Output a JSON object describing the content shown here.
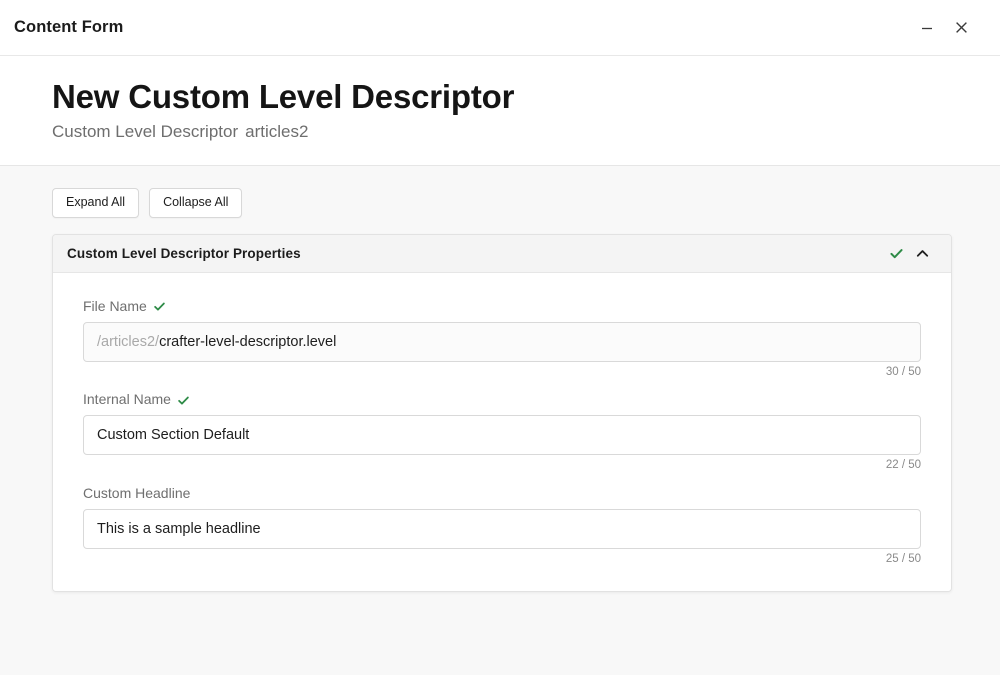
{
  "window": {
    "title": "Content Form",
    "minimize_label": "Minimize",
    "close_label": "Close",
    "minimize_icon": "minimize-icon",
    "close_icon": "close-icon"
  },
  "page_header": {
    "title": "New Custom Level Descriptor",
    "subtitle_type": "Custom Level Descriptor",
    "subtitle_path": "articles2"
  },
  "toolbar": {
    "expand_all_label": "Expand All",
    "collapse_all_label": "Collapse All"
  },
  "section": {
    "title": "Custom Level Descriptor Properties",
    "valid_icon": "check-icon",
    "toggle_icon": "chevron-up-icon",
    "expanded": true,
    "valid_color": "#2e8b47"
  },
  "fields": [
    {
      "label": "File Name",
      "has_check": true,
      "prefix": "/articles2/",
      "value": "crafter-level-descriptor.level",
      "placeholder": "",
      "counter": "30 / 50",
      "readonly_style": true
    },
    {
      "label": "Internal Name",
      "has_check": true,
      "prefix": "",
      "value": "Custom Section Default",
      "placeholder": "",
      "counter": "22 / 50",
      "readonly_style": false
    },
    {
      "label": "Custom Headline",
      "has_check": false,
      "prefix": "",
      "value": "This is a sample headline",
      "placeholder": "",
      "counter": "25 / 50",
      "readonly_style": false
    }
  ]
}
